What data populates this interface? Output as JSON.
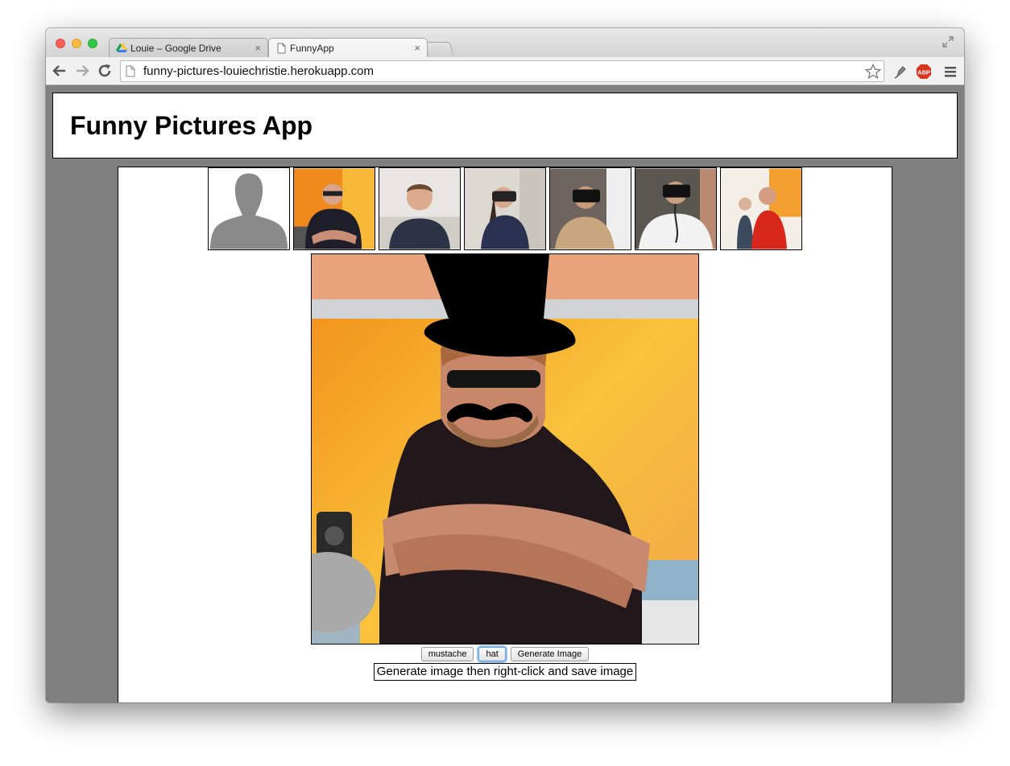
{
  "browser": {
    "tabs": [
      {
        "title": "Louie – Google Drive",
        "close": "×",
        "active": false
      },
      {
        "title": "FunnyApp",
        "close": "×",
        "active": true
      }
    ],
    "url": "funny-pictures-louiechristie.herokuapp.com",
    "extension_badge": "ABP"
  },
  "app": {
    "title": "Funny Pictures App",
    "thumbnails": [
      {
        "name": "silhouette"
      },
      {
        "name": "man-sunglasses"
      },
      {
        "name": "man-smiling"
      },
      {
        "name": "woman-vr-headset"
      },
      {
        "name": "man-vr-headset"
      },
      {
        "name": "man-vr-headset-2"
      },
      {
        "name": "man-red-shirt"
      }
    ],
    "overlays": [
      "hat",
      "mustache"
    ],
    "buttons": {
      "mustache": "mustache",
      "hat": "hat",
      "generate": "Generate Image"
    },
    "hint": "Generate image then right-click and save image"
  },
  "colors": {
    "viewport_bg": "#808080",
    "button_focus": "#5b9be6"
  }
}
